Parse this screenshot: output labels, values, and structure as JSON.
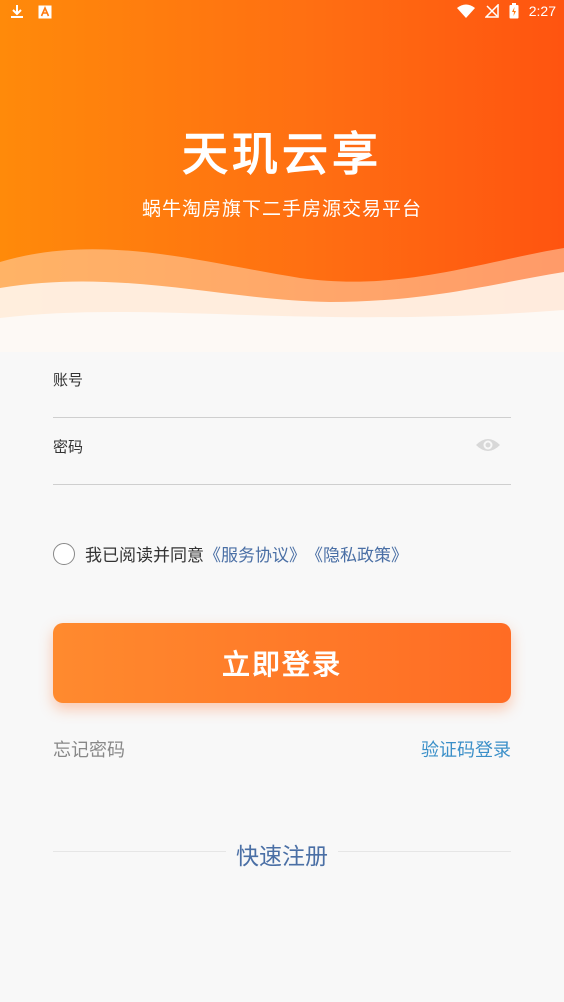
{
  "status_bar": {
    "time": "2:27",
    "left_icons": [
      "download-icon",
      "a-icon"
    ],
    "right_icons": [
      "wifi-icon",
      "no-signal-icon",
      "battery-icon"
    ]
  },
  "header": {
    "title": "天玑云享",
    "subtitle": "蜗牛淘房旗下二手房源交易平台",
    "gradient_colors": [
      "#ff8a0a",
      "#ff5410"
    ]
  },
  "form": {
    "account_label": "账号",
    "account_value": "",
    "password_label": "密码",
    "password_value": "",
    "password_toggle_icon": "eye-icon"
  },
  "agreement": {
    "checked": false,
    "text": "我已阅读并同意",
    "service_link": "《服务协议》",
    "privacy_link": "《隐私政策》"
  },
  "actions": {
    "login_label": "立即登录",
    "forgot_label": "忘记密码",
    "code_login_label": "验证码登录",
    "register_label": "快速注册"
  },
  "colors": {
    "accent": "#ff6c24",
    "link": "#4a6fa5",
    "code_link": "#3a8fc8"
  }
}
